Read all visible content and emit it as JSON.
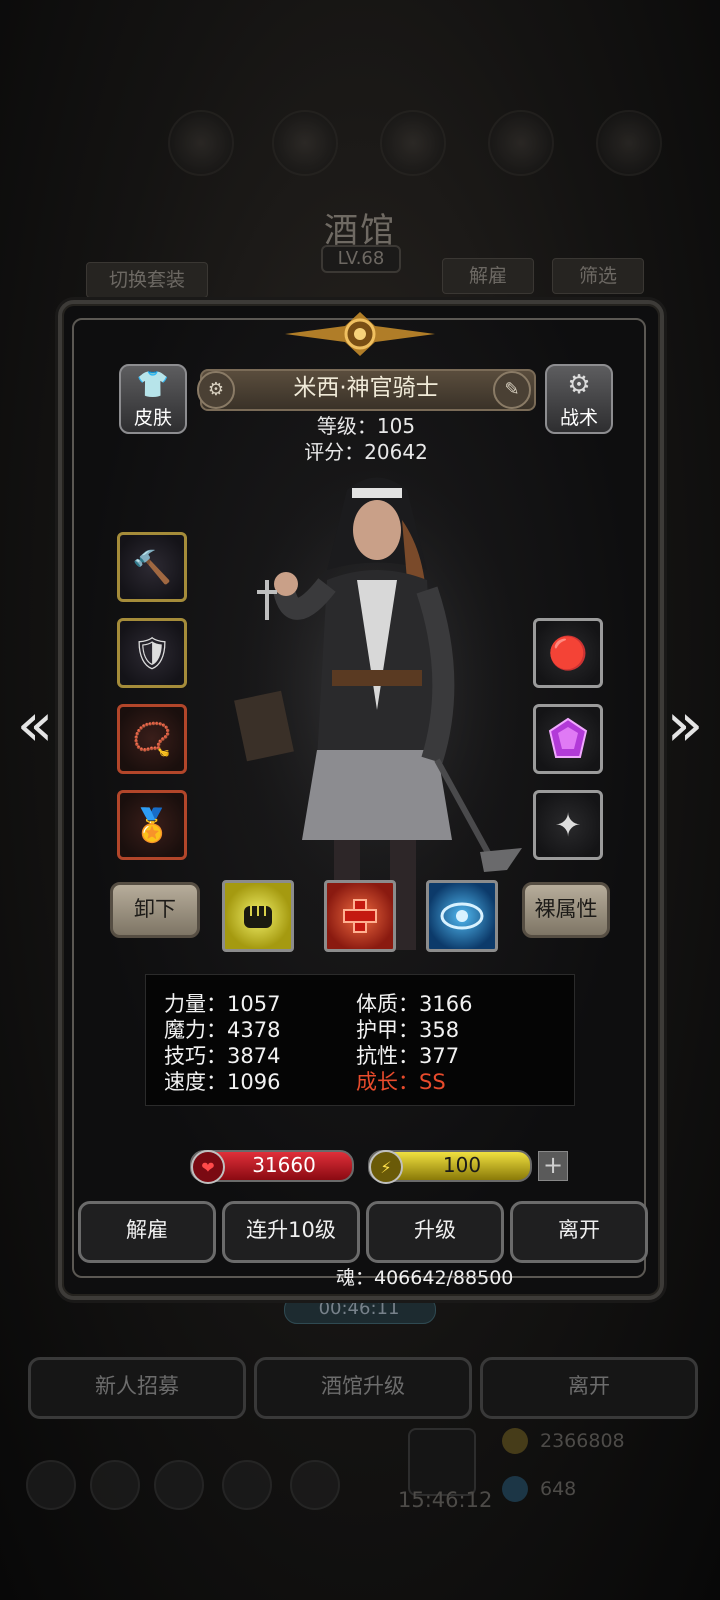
{
  "background": {
    "title": "酒馆",
    "level": "LV.68",
    "switch_set": "切换套装",
    "dismiss": "解雇",
    "filter": "筛选",
    "timer": "00:46:11",
    "buttons": [
      "新人招募",
      "酒馆升级",
      "离开"
    ],
    "gold": "2366808",
    "gems": "648",
    "clock": "15:46:12"
  },
  "hero": {
    "name": "米西·神官骑士",
    "level": "等级：105",
    "score": "评分：20642",
    "skin": "皮肤",
    "tactics": "战术"
  },
  "equipment": {
    "left": [
      "mace-icon",
      "armor-icon",
      "amulet-icon",
      "medal-icon"
    ],
    "right": [
      "red-orb-icon",
      "purple-gem-icon",
      "silver-emblem-icon"
    ]
  },
  "controls": {
    "unequip": "卸下",
    "bare_attr": "裸属性"
  },
  "skills": [
    "fist-icon",
    "cross-icon",
    "eye-icon"
  ],
  "stats": {
    "str": "力量：1057",
    "con": "体质：3166",
    "mag": "魔力：4378",
    "armor": "护甲：358",
    "skill": "技巧：3874",
    "res": "抗性：377",
    "spd": "速度：1096",
    "growth": "成长：SS"
  },
  "bars": {
    "hp": "31660",
    "energy": "100",
    "plus": "+"
  },
  "actions": [
    "解雇",
    "连升10级",
    "升级",
    "离开"
  ],
  "soul": "魂：406642/88500",
  "colors": {
    "hp": "#c8141c",
    "energy": "#d8c820",
    "growth": "#e84b2c"
  }
}
